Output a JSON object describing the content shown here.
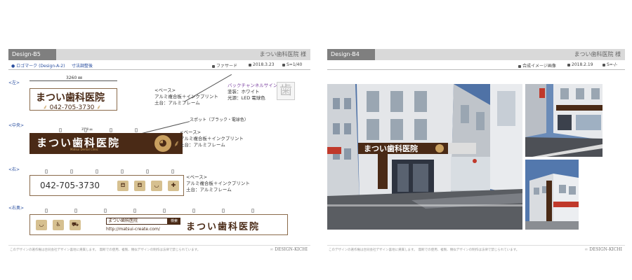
{
  "left": {
    "tag": "Design-B5",
    "client": "まつい歯科医院 様",
    "sub_logo": "ロゴマーク (Design-A-2)",
    "sub_dim": "寸法調整後",
    "sub_facade": "ファサード",
    "sub_date": "2018.3.23",
    "sub_scale": "S=1/40",
    "dim_top": "3260 ㎜",
    "dim_mid": "3520 ㎜",
    "side_left": "<左>",
    "side_center": "<中央>",
    "side_right": "<右>",
    "side_right_oblique": "<右奥>",
    "sign1_name": "まつい歯科医院",
    "sign1_tel": "042-705-3730",
    "sign2_name": "まつい歯科医院",
    "sign2_sub": "Matsui Dental Clinic",
    "sign3_tel": "042-705-3730",
    "sign4_name": "まつい歯科医院",
    "sign4_url": "http://matsui-create.com/",
    "sign4_label": "まつい歯科医院",
    "sign4_tag": "検索",
    "note1": [
      "<ベース>",
      "アルミ複合板＋インクプリント",
      "土台：アルミフレーム"
    ],
    "note_channel": [
      "バックチャンネルサイン",
      "塗装：ホワイト",
      "光源：LED 電球色"
    ],
    "note_spot": "スポット（ブラック・電球色）",
    "note2": [
      "<ベース>",
      "アルミ複合板＋インクプリント",
      "土台：アルミフレーム"
    ],
    "note3": [
      "<ベース>",
      "アルミ複合板＋インクプリント",
      "土台：アルミフレーム"
    ],
    "foot_note": "このデザインの著作権は合同会社デザイン喜地に帰属します。　無断での使用、複製、類似デザインの制作は法律で禁じられています。",
    "foot_logo": "DESIGN-KICHI"
  },
  "right": {
    "tag": "Design-B4",
    "client": "まつい歯科医院 様",
    "sub_comp": "合成イメージ画像",
    "sub_date": "2018.2.19",
    "sub_scale": "S=-/-",
    "photo_sign": "まつい歯科医院",
    "foot_note": "このデザインの著作権は合同会社デザイン喜地に帰属します。　無断での使用、複製、類似デザインの制作は法律で禁じられています。",
    "foot_logo": "DESIGN-KICHI"
  },
  "colors": {
    "brown": "#4a2a16",
    "gold": "#c9a060",
    "accent_blue": "#2a4fa0",
    "accent_purple": "#7a3fa0"
  }
}
